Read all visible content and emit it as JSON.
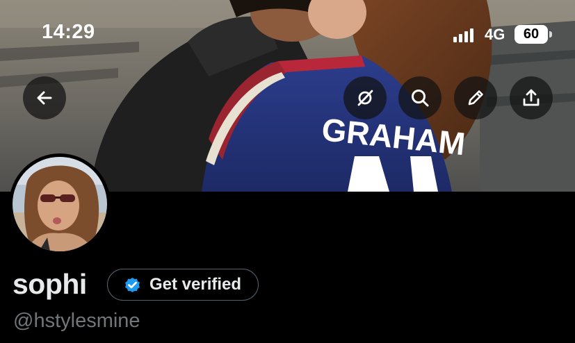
{
  "status_bar": {
    "time": "14:29",
    "network": "4G",
    "battery": "60"
  },
  "header_actions": {
    "back_icon": "arrow-left-icon",
    "grok_icon": "grok-icon",
    "search_icon": "search-icon",
    "edit_icon": "pencil-icon",
    "share_icon": "share-icon"
  },
  "banner": {
    "jersey_text": "GRAHAM"
  },
  "profile": {
    "display_name": "sophi",
    "get_verified_label": "Get verified",
    "handle": "@hstylesmine"
  },
  "colors": {
    "verified_badge": "#1d9bf0",
    "pill_border": "#536471",
    "handle_text": "#71767b"
  }
}
